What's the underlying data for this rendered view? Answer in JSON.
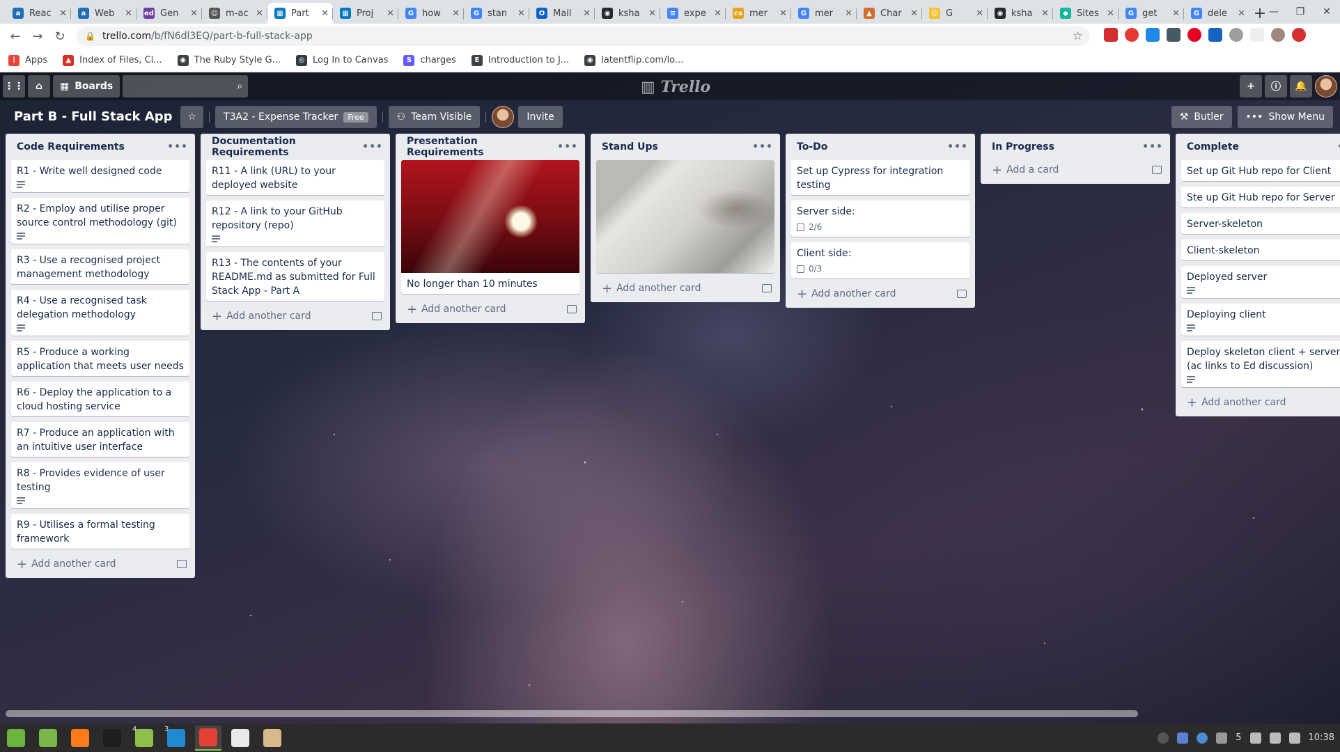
{
  "browser": {
    "tabs": [
      {
        "label": "Reac",
        "color": "#1f6fb5",
        "glyph": "a"
      },
      {
        "label": "Web",
        "color": "#1f6fb5",
        "glyph": "a"
      },
      {
        "label": "Gen",
        "color": "#6b3fa0",
        "glyph": "ed"
      },
      {
        "label": "m-ac",
        "color": "#555555",
        "glyph": "☺"
      },
      {
        "label": "Part",
        "color": "#0079bf",
        "glyph": "▦",
        "active": true
      },
      {
        "label": "Proj",
        "color": "#0079bf",
        "glyph": "▦"
      },
      {
        "label": "how",
        "color": "#4285f4",
        "glyph": "G"
      },
      {
        "label": "stan",
        "color": "#4285f4",
        "glyph": "G"
      },
      {
        "label": "Mail",
        "color": "#0a64c8",
        "glyph": "O"
      },
      {
        "label": "ksha",
        "color": "#24292e",
        "glyph": "◉"
      },
      {
        "label": "expe",
        "color": "#4285f4",
        "glyph": "≡"
      },
      {
        "label": "mer",
        "color": "#e8a317",
        "glyph": "cs"
      },
      {
        "label": "mer",
        "color": "#4285f4",
        "glyph": "G"
      },
      {
        "label": "Char",
        "color": "#d46a2c",
        "glyph": "▲"
      },
      {
        "label": "G",
        "color": "#f4c430",
        "glyph": "☺"
      },
      {
        "label": "ksha",
        "color": "#24292e",
        "glyph": "◉"
      },
      {
        "label": "Sites",
        "color": "#12b5a0",
        "glyph": "◆"
      },
      {
        "label": "get",
        "color": "#4285f4",
        "glyph": "G"
      },
      {
        "label": "dele",
        "color": "#4285f4",
        "glyph": "G"
      }
    ],
    "url_host": "trello.com",
    "url_path": "/b/fN6dl3EQ/part-b-full-stack-app",
    "bookmarks": [
      {
        "label": "Apps",
        "color": "#ea4335",
        "glyph": "⋮"
      },
      {
        "label": "Index of Files, Cl...",
        "color": "#d93025",
        "glyph": "▲"
      },
      {
        "label": "The Ruby Style G...",
        "color": "#3c4043",
        "glyph": "◉"
      },
      {
        "label": "Log In to Canvas",
        "color": "#2d3b45",
        "glyph": "◎"
      },
      {
        "label": "charges",
        "color": "#635bff",
        "glyph": "S"
      },
      {
        "label": "Introduction to J...",
        "color": "#3c4043",
        "glyph": "E"
      },
      {
        "label": "latentflip.com/lo...",
        "color": "#3c4043",
        "glyph": "◉"
      }
    ]
  },
  "trello": {
    "boards_label": "Boards",
    "logo": "Trello",
    "board_title": "Part B - Full Stack App",
    "team_label": "T3A2 - Expense Tracker",
    "free_badge": "Free",
    "visibility_label": "Team Visible",
    "invite_label": "Invite",
    "butler_label": "Butler",
    "show_menu_label": "Show Menu"
  },
  "lists": [
    {
      "title": "Code Requirements",
      "cards": [
        {
          "text": "R1 - Write well designed code",
          "desc": true
        },
        {
          "text": "R2 - Employ and utilise proper source control methodology (git)",
          "desc": true
        },
        {
          "text": "R3 - Use a recognised project management methodology",
          "desc": false
        },
        {
          "text": "R4 - Use a recognised task delegation methodology",
          "desc": true
        },
        {
          "text": "R5 - Produce a working application that meets user needs",
          "desc": false
        },
        {
          "text": "R6 - Deploy the application to a cloud hosting service",
          "desc": false
        },
        {
          "text": "R7 - Produce an application with an intuitive user interface",
          "desc": false
        },
        {
          "text": "R8 - Provides evidence of user testing",
          "desc": true
        },
        {
          "text": "R9 - Utilises a formal testing framework",
          "desc": false
        }
      ],
      "add_label": "Add another card"
    },
    {
      "title": "Documentation Requirements",
      "cards": [
        {
          "text": "R11 - A link (URL) to your deployed website",
          "desc": false
        },
        {
          "text": "R12 - A link to your GitHub repository (repo)",
          "desc": true
        },
        {
          "text": "R13 - The contents of your README.md as submitted for Full Stack App - Part A",
          "desc": false
        }
      ],
      "add_label": "Add another card"
    },
    {
      "title": "Presentation Requirements",
      "cards": [
        {
          "text": "No longer than 10 minutes",
          "cover": "projector"
        }
      ],
      "add_label": "Add another card"
    },
    {
      "title": "Stand Ups",
      "cards": [
        {
          "text": "",
          "cover": "laptop"
        }
      ],
      "add_label": "Add another card"
    },
    {
      "title": "To-Do",
      "cards": [
        {
          "text": "Set up Cypress for integration testing",
          "desc": false
        },
        {
          "text": "Server side:",
          "checklist": "2/6"
        },
        {
          "text": "Client side:",
          "checklist": "0/3"
        }
      ],
      "add_label": "Add another card"
    },
    {
      "title": "In Progress",
      "cards": [],
      "add_label": "Add a card"
    },
    {
      "title": "Complete",
      "cards": [
        {
          "text": "Set up Git Hub repo for Client",
          "desc": false
        },
        {
          "text": "Ste up Git Hub repo for Server",
          "desc": false
        },
        {
          "text": "Server-skeleton",
          "desc": false
        },
        {
          "text": "Client-skeleton",
          "desc": false
        },
        {
          "text": "Deployed server",
          "desc": true
        },
        {
          "text": "Deploying client",
          "desc": true
        },
        {
          "text": "Deploy skeleton client + server (ac links to Ed discussion)",
          "desc": true
        }
      ],
      "add_label": "Add another card"
    }
  ],
  "taskbar": {
    "apps": [
      {
        "name": "mint-menu-icon",
        "color": "#69b53f"
      },
      {
        "name": "files-icon",
        "color": "#7ab648"
      },
      {
        "name": "firefox-icon",
        "color": "#ff7a1a"
      },
      {
        "name": "terminal-icon",
        "color": "#1e1e1e",
        "num": ""
      },
      {
        "name": "folder-icon",
        "color": "#8fbf4a",
        "num": "4"
      },
      {
        "name": "vscode-icon",
        "color": "#1f8ad2",
        "num": "3"
      },
      {
        "name": "chrome-icon",
        "color": "#e34133",
        "active": true
      },
      {
        "name": "slack-icon",
        "color": "#e9e9e9"
      },
      {
        "name": "notes-icon",
        "color": "#d9b98a"
      }
    ],
    "tray_count": "5",
    "clock": "10:38"
  }
}
